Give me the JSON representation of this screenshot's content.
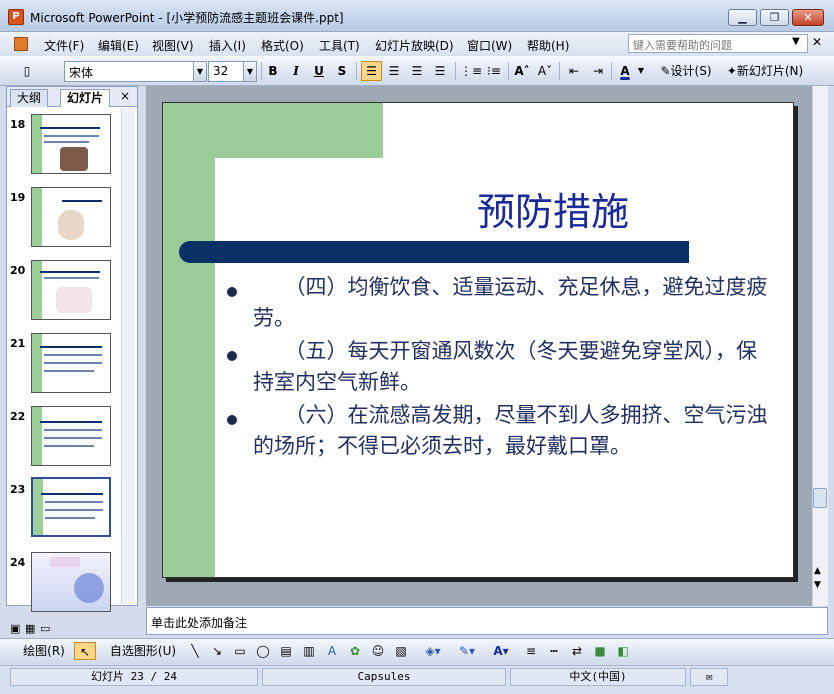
{
  "window": {
    "app_icon": "powerpoint-icon",
    "title": "Microsoft PowerPoint - [小学预防流感主题班会课件.ppt]",
    "controls": [
      "minimize",
      "restore",
      "close"
    ]
  },
  "menu": {
    "items": [
      "文件(F)",
      "编辑(E)",
      "视图(V)",
      "插入(I)",
      "格式(O)",
      "工具(T)",
      "幻灯片放映(D)",
      "窗口(W)",
      "帮助(H)"
    ],
    "help_placeholder": "键入需要帮助的问题",
    "close_glyph": "✕"
  },
  "toolbar": {
    "font_name": "宋体",
    "font_size": "32",
    "bold": "B",
    "italic": "I",
    "underline": "U",
    "shadow": "S",
    "design": "设计(S)",
    "new_slide": "新幻灯片(N)"
  },
  "left_pane": {
    "tabs": [
      "大纲",
      "幻灯片"
    ],
    "close": "×",
    "thumbnails": [
      {
        "number": "18"
      },
      {
        "number": "19"
      },
      {
        "number": "20"
      },
      {
        "number": "21"
      },
      {
        "number": "22"
      },
      {
        "number": "23",
        "selected": true
      },
      {
        "number": "24"
      }
    ]
  },
  "slide": {
    "title": "预防措施",
    "bullets": [
      "　　（四）均衡饮食、适量运动、充足休息，避免过度疲劳。",
      "　　（五）每天开窗通风数次（冬天要避免穿堂风），保持室内空气新鲜。",
      "　　（六）在流感高发期，尽量不到人多拥挤、空气污浊的场所；不得已必须去时，最好戴口罩。"
    ],
    "colors": {
      "title": "#1a2a9c",
      "green": "#9ccd98",
      "bar": "#0b3066"
    }
  },
  "notes": {
    "placeholder": "单击此处添加备注"
  },
  "drawing": {
    "draw": "绘图(R)",
    "autoshape": "自选图形(U)"
  },
  "status": {
    "slide": "幻灯片 23 / 24",
    "design": "Capsules",
    "language": "中文(中国)"
  }
}
